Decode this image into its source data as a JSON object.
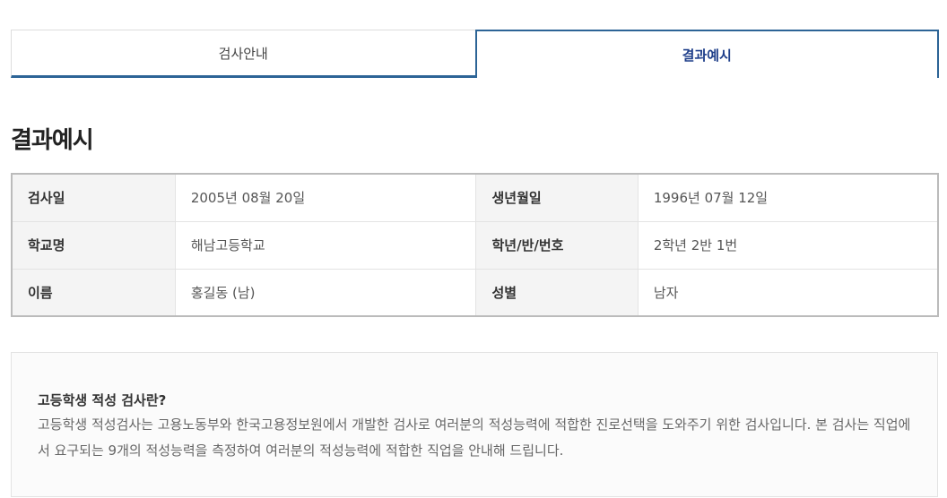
{
  "tabs": [
    {
      "label": "검사안내",
      "active": false
    },
    {
      "label": "결과예시",
      "active": true
    }
  ],
  "page_title": "결과예시",
  "info_table": {
    "rows": [
      {
        "label1": "검사일",
        "value1": "2005년 08월 20일",
        "label2": "생년월일",
        "value2": "1996년 07월 12일"
      },
      {
        "label1": "학교명",
        "value1": "해남고등학교",
        "label2": "학년/반/번호",
        "value2": "2학년 2반 1번"
      },
      {
        "label1": "이름",
        "value1": "홍길동 (남)",
        "label2": "성별",
        "value2": "남자"
      }
    ]
  },
  "description": {
    "title": "고등학생 적성 검사란?",
    "body": "고등학생 적성검사는 고용노동부와 한국고용정보원에서 개발한 검사로 여러분의 적성능력에 적합한 진로선택을 도와주기 위한 검사입니다. 본 검사는 직업에서 요구되는 9개의 적성능력을 측정하여 여러분의 적성능력에 적합한 직업을 안내해 드립니다."
  },
  "colors": {
    "accent": "#2c6496",
    "active_tab_text": "#1f3f8a"
  }
}
